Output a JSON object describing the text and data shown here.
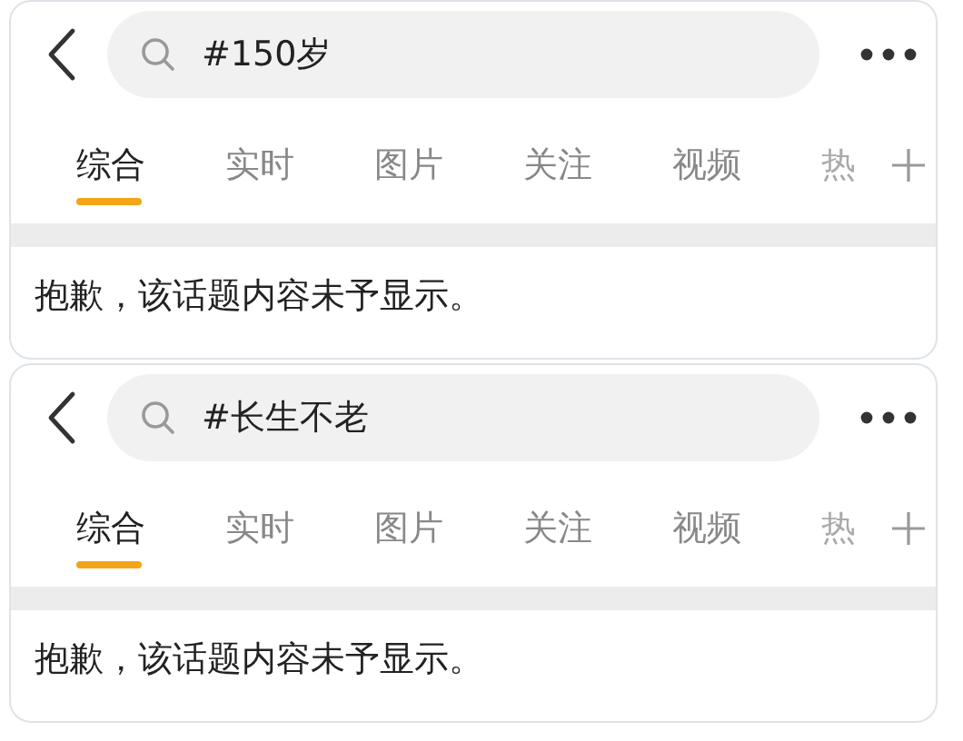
{
  "panels": [
    {
      "search": {
        "query": "#150岁"
      },
      "tabs": [
        {
          "label": "综合",
          "selected": true
        },
        {
          "label": "实时",
          "selected": false
        },
        {
          "label": "图片",
          "selected": false
        },
        {
          "label": "关注",
          "selected": false
        },
        {
          "label": "视频",
          "selected": false
        },
        {
          "label": "热",
          "selected": false
        }
      ],
      "message": "抱歉，该话题内容未予显示。"
    },
    {
      "search": {
        "query": "#长生不老"
      },
      "tabs": [
        {
          "label": "综合",
          "selected": true
        },
        {
          "label": "实时",
          "selected": false
        },
        {
          "label": "图片",
          "selected": false
        },
        {
          "label": "关注",
          "selected": false
        },
        {
          "label": "视频",
          "selected": false
        },
        {
          "label": "热",
          "selected": false
        }
      ],
      "message": "抱歉，该话题内容未予显示。"
    }
  ]
}
